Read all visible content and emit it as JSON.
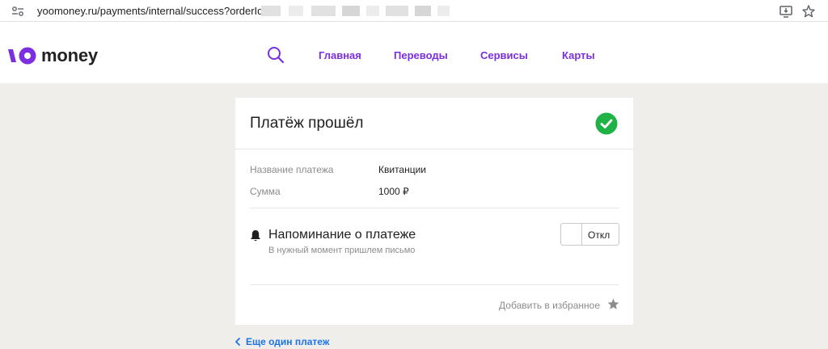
{
  "browser": {
    "url": "yoomoney.ru/payments/internal/success?orderId=",
    "icons": [
      "site-info-icon",
      "install-app-icon",
      "bookmark-star-icon"
    ]
  },
  "header": {
    "logo_text": "money",
    "nav": [
      "Главная",
      "Переводы",
      "Сервисы",
      "Карты"
    ],
    "accent_color": "#7b2fe0"
  },
  "card": {
    "title": "Платёж прошёл",
    "status_color": "#1fb347",
    "details": [
      {
        "label": "Название платежа",
        "value": "Квитанции"
      },
      {
        "label": "Сумма",
        "value": "1000 ₽"
      }
    ],
    "reminder": {
      "title": "Напоминание о платеже",
      "subtitle": "В нужный момент пришлем письмо",
      "toggle_label": "Откл"
    },
    "favorite_label": "Добавить в избранное"
  },
  "back_link": "Еще один платеж"
}
